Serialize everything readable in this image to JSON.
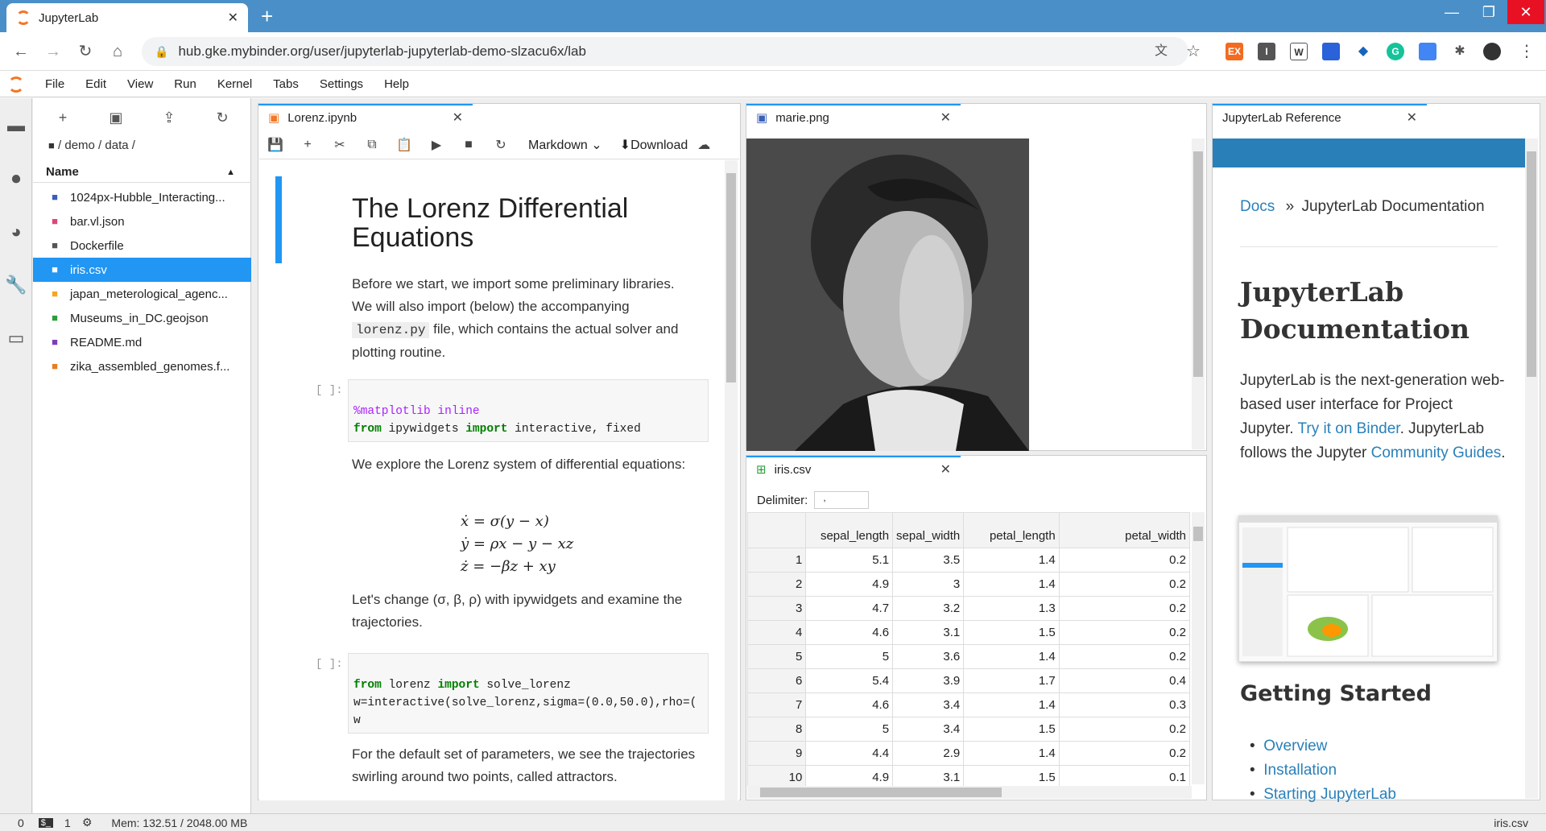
{
  "browser": {
    "tab_title": "JupyterLab",
    "new_tab": "+",
    "url": "hub.gke.mybinder.org/user/jupyterlab-jupyterlab-demo-slzacu6x/lab",
    "window_controls": [
      "—",
      "❐",
      "✕"
    ],
    "extensions": [
      "EX",
      "I",
      "W",
      "",
      "",
      "G",
      "",
      "",
      ""
    ]
  },
  "menubar": {
    "items": [
      "File",
      "Edit",
      "View",
      "Run",
      "Kernel",
      "Tabs",
      "Settings",
      "Help"
    ]
  },
  "filebrowser": {
    "breadcrumbs": "/ demo / data /",
    "column_name": "Name",
    "files": [
      {
        "name": "1024px-Hubble_Interacting...",
        "icon": "image-icon",
        "color": "#3b5fb5"
      },
      {
        "name": "bar.vl.json",
        "icon": "vega-icon",
        "color": "#e0457b"
      },
      {
        "name": "Dockerfile",
        "icon": "file-icon",
        "color": "#555555"
      },
      {
        "name": "iris.csv",
        "icon": "spreadsheet-icon",
        "color": "#ffffff",
        "selected": true
      },
      {
        "name": "japan_meterological_agenc...",
        "icon": "json-icon",
        "color": "#f5a623"
      },
      {
        "name": "Museums_in_DC.geojson",
        "icon": "map-icon",
        "color": "#2a9d3c"
      },
      {
        "name": "README.md",
        "icon": "markdown-icon",
        "color": "#7b3fb8"
      },
      {
        "name": "zika_assembled_genomes.f...",
        "icon": "fasta-icon",
        "color": "#e67e22"
      }
    ]
  },
  "notebook": {
    "tab_title": "Lorenz.ipynb",
    "cell_type": "Markdown",
    "download": "Download",
    "heading": "The Lorenz Differential Equations",
    "p1": "Before we start, we import some preliminary libraries. We will also import (below) the accompanying",
    "p1_code": "lorenz.py",
    "p1_rest": "file, which contains the actual solver and plotting routine.",
    "prompt": "[ ]:",
    "code1_l1_magic": "%matplotlib inline",
    "code1_l2_a": "from",
    "code1_l2_b": " ipywidgets ",
    "code1_l2_c": "import",
    "code1_l2_d": " interactive, fixed",
    "p2": "We explore the Lorenz system of differential equations:",
    "eq1": "ẋ = σ(y − x)",
    "eq2": "ẏ = ρx − y − xz",
    "eq3": "ż = −βz + xy",
    "p3": "Let's change (σ, β, ρ) with ipywidgets and examine the trajectories.",
    "code2_l1_a": "from",
    "code2_l1_b": " lorenz ",
    "code2_l1_c": "import",
    "code2_l1_d": " solve_lorenz",
    "code2_l2": "w=interactive(solve_lorenz,sigma=(0.0,50.0),rho=(",
    "code2_l3": "w",
    "p4": "For the default set of parameters, we see the trajectories swirling around two points, called attractors."
  },
  "image_panel": {
    "tab_title": "marie.png"
  },
  "csv_panel": {
    "tab_title": "iris.csv",
    "delimiter_label": "Delimiter:",
    "delimiter_value": ",",
    "columns": [
      "",
      "sepal_length",
      "sepal_width",
      "petal_length",
      "petal_width"
    ],
    "rows": [
      [
        "1",
        "5.1",
        "3.5",
        "1.4",
        "0.2"
      ],
      [
        "2",
        "4.9",
        "3",
        "1.4",
        "0.2"
      ],
      [
        "3",
        "4.7",
        "3.2",
        "1.3",
        "0.2"
      ],
      [
        "4",
        "4.6",
        "3.1",
        "1.5",
        "0.2"
      ],
      [
        "5",
        "5",
        "3.6",
        "1.4",
        "0.2"
      ],
      [
        "6",
        "5.4",
        "3.9",
        "1.7",
        "0.4"
      ],
      [
        "7",
        "4.6",
        "3.4",
        "1.4",
        "0.3"
      ],
      [
        "8",
        "5",
        "3.4",
        "1.5",
        "0.2"
      ],
      [
        "9",
        "4.4",
        "2.9",
        "1.4",
        "0.2"
      ],
      [
        "10",
        "4.9",
        "3.1",
        "1.5",
        "0.1"
      ]
    ]
  },
  "docs": {
    "tab_title": "JupyterLab Reference",
    "crumb_link": "Docs",
    "crumb_sep": "»",
    "crumb_current": "JupyterLab Documentation",
    "title": "JupyterLab Documentation",
    "intro_1": "JupyterLab is the next-generation web-based user interface for Project Jupyter.",
    "intro_link1": "Try it on Binder",
    "intro_2": ". JupyterLab follows the Jupyter",
    "intro_link2": "Community Guides",
    "intro_3": ".",
    "section": "Getting Started",
    "links": [
      "Overview",
      "Installation",
      "Starting JupyterLab"
    ]
  },
  "status": {
    "left_0": "0",
    "left_1": "1",
    "mem": "Mem: 132.51 / 2048.00 MB",
    "right": "iris.csv"
  }
}
